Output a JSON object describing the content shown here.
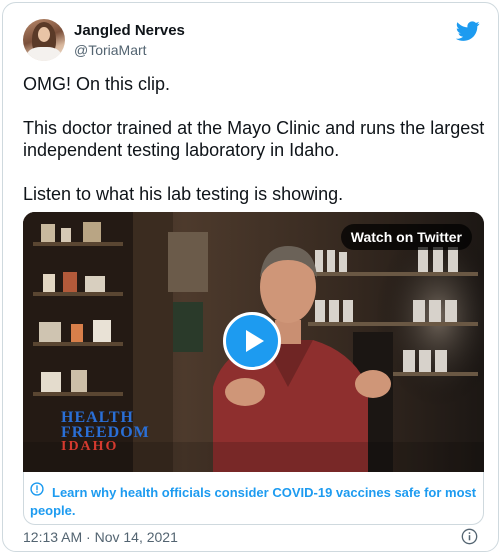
{
  "tweet": {
    "display_name": "Jangled Nerves",
    "handle": "@ToriaMart",
    "paragraphs": [
      "OMG!  On this clip.",
      "This doctor trained at the Mayo Clinic and runs the largest independent testing laboratory in Idaho.",
      "Listen to what his lab testing is showing."
    ],
    "timestamp": "12:13 AM · Nov 14, 2021"
  },
  "media": {
    "watch_label": "Watch on Twitter",
    "logo_line1": "HEALTH",
    "logo_line2": "FREEDOM",
    "logo_line3": "IDAHO",
    "icons": [
      "play-icon"
    ]
  },
  "notice": {
    "text": "Learn why health officials consider COVID-19 vaccines safe for most people."
  },
  "colors": {
    "accent": "#1d9bf0",
    "text_primary": "#0f1419",
    "text_secondary": "#536471",
    "border": "#cfd9de"
  }
}
